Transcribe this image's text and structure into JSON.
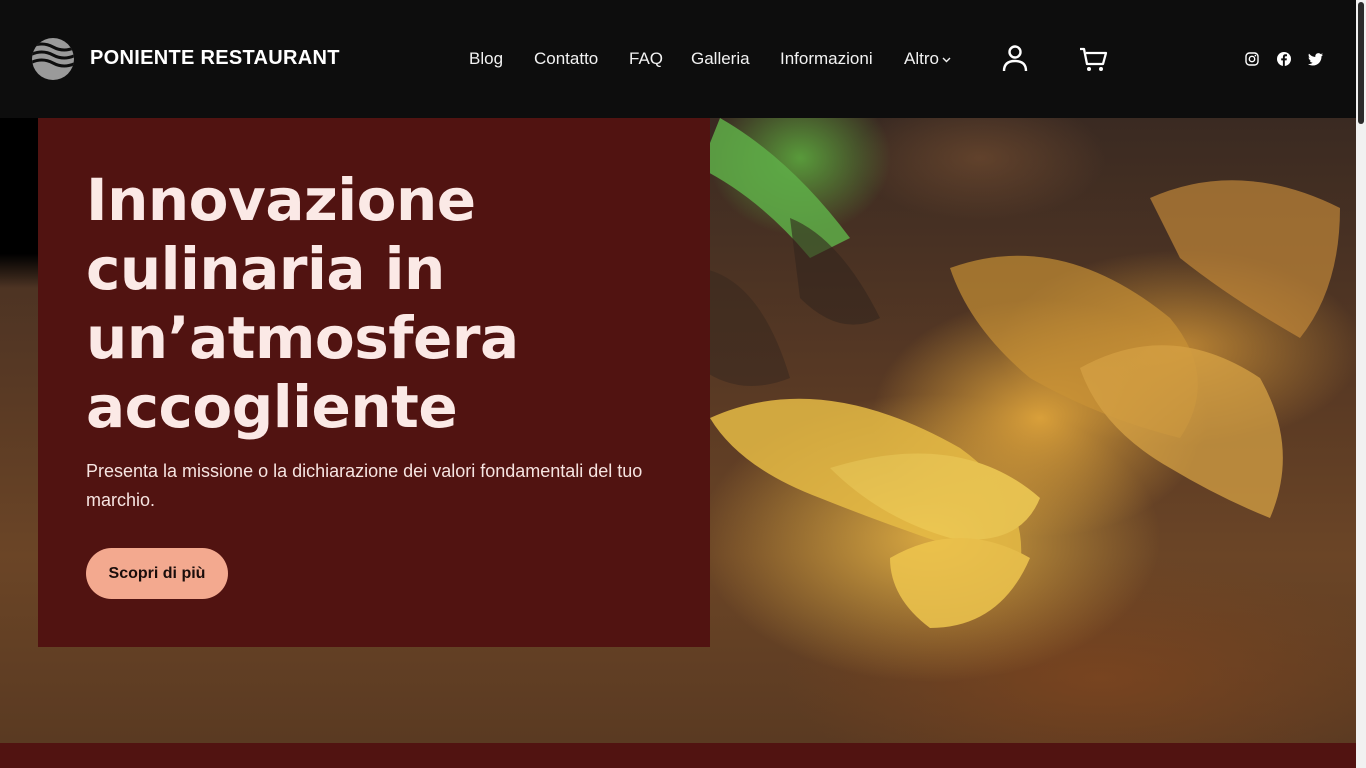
{
  "header": {
    "site_title": "PONIENTE RESTAURANT",
    "logo_icon": "waves-globe-icon",
    "nav": [
      {
        "label": "Blog"
      },
      {
        "label": "Contatto"
      },
      {
        "label": "FAQ"
      },
      {
        "label": "Galleria"
      },
      {
        "label": "Informazioni"
      },
      {
        "label": "Altro",
        "has_dropdown": true
      }
    ],
    "icons": [
      "user-icon",
      "cart-icon"
    ],
    "social": [
      "instagram-icon",
      "facebook-icon",
      "twitter-icon"
    ]
  },
  "hero": {
    "heading_lines": [
      "Innovazione",
      "culinaria in",
      "un’atmosfera",
      "accogliente"
    ],
    "subtitle": "Presenta la missione o la dichiarazione dei valori fondamentali del tuo marchio.",
    "button_label": "Scopri di più",
    "background_image": "blurred fries and fried onions on wooden board"
  },
  "colors": {
    "header_bg": "#0d0d0d",
    "card_bg": "#511311",
    "button_bg": "#f3a98f",
    "heading_text": "#fbe9e6"
  }
}
